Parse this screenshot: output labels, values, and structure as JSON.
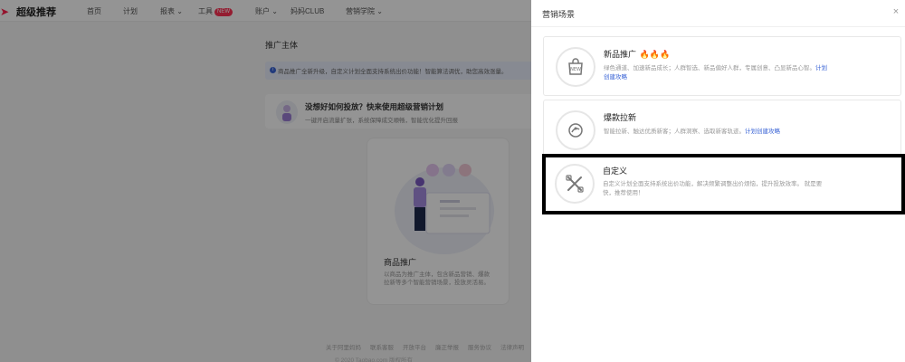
{
  "topnav": {
    "logo_text": "超级推荐",
    "items": [
      {
        "label": "首页"
      },
      {
        "label": "计划"
      },
      {
        "label": "报表 ⌄"
      },
      {
        "label": "工具",
        "badge": "NEW"
      },
      {
        "label": "账户 ⌄"
      },
      {
        "label": "妈妈CLUB"
      },
      {
        "label": "营销学院 ⌄"
      }
    ]
  },
  "page": {
    "title": "推广主体",
    "notice": "商品推广全新升级，自定义计划全面支持系统出价功能！智能算法调优，助您高效涨量。",
    "promo": {
      "heading": "没想好如何投放？快来使用超级营销计划",
      "sub": "一键开启流量扩张，系统保障成交顺畅，智能优化提升回报"
    },
    "card": {
      "name": "商品推广",
      "desc": "以商品为推广主体，包含新品营销、爆款拉新等多个智能营销场景，投放灵活易。"
    },
    "footer_links": [
      "关于阿里妈妈",
      "联系客服",
      "开放平台",
      "廉正举报",
      "服务协议",
      "法律声明"
    ],
    "footer_copyright": "© 2020 Taobao.com 版权所有"
  },
  "drawer": {
    "title": "营销场景",
    "close": "×",
    "scenes": [
      {
        "name": "新品推广",
        "fires": "🔥🔥🔥",
        "desc": "绿色通道、加速新品成长；人群智选、新品偏好人群，专属创意、凸显新品心智。",
        "link": "计划创建攻略",
        "icon": "new-bag-icon"
      },
      {
        "name": "爆款拉新",
        "desc": "智能拉新、触达优质新客；人群洞察、选取新客轨迹。",
        "link": "计划创建攻略",
        "icon": "rocket-icon"
      },
      {
        "name": "自定义",
        "desc": "自定义计划全面支持系统出价功能，解决频繁调整出价烦恼，提升投放效率。 就是要快，推荐使用！",
        "icon": "tools-icon"
      }
    ]
  },
  "colors": {
    "accent": "#ff1f4d",
    "link": "#3a64d6",
    "highlight_border": "#000000"
  }
}
